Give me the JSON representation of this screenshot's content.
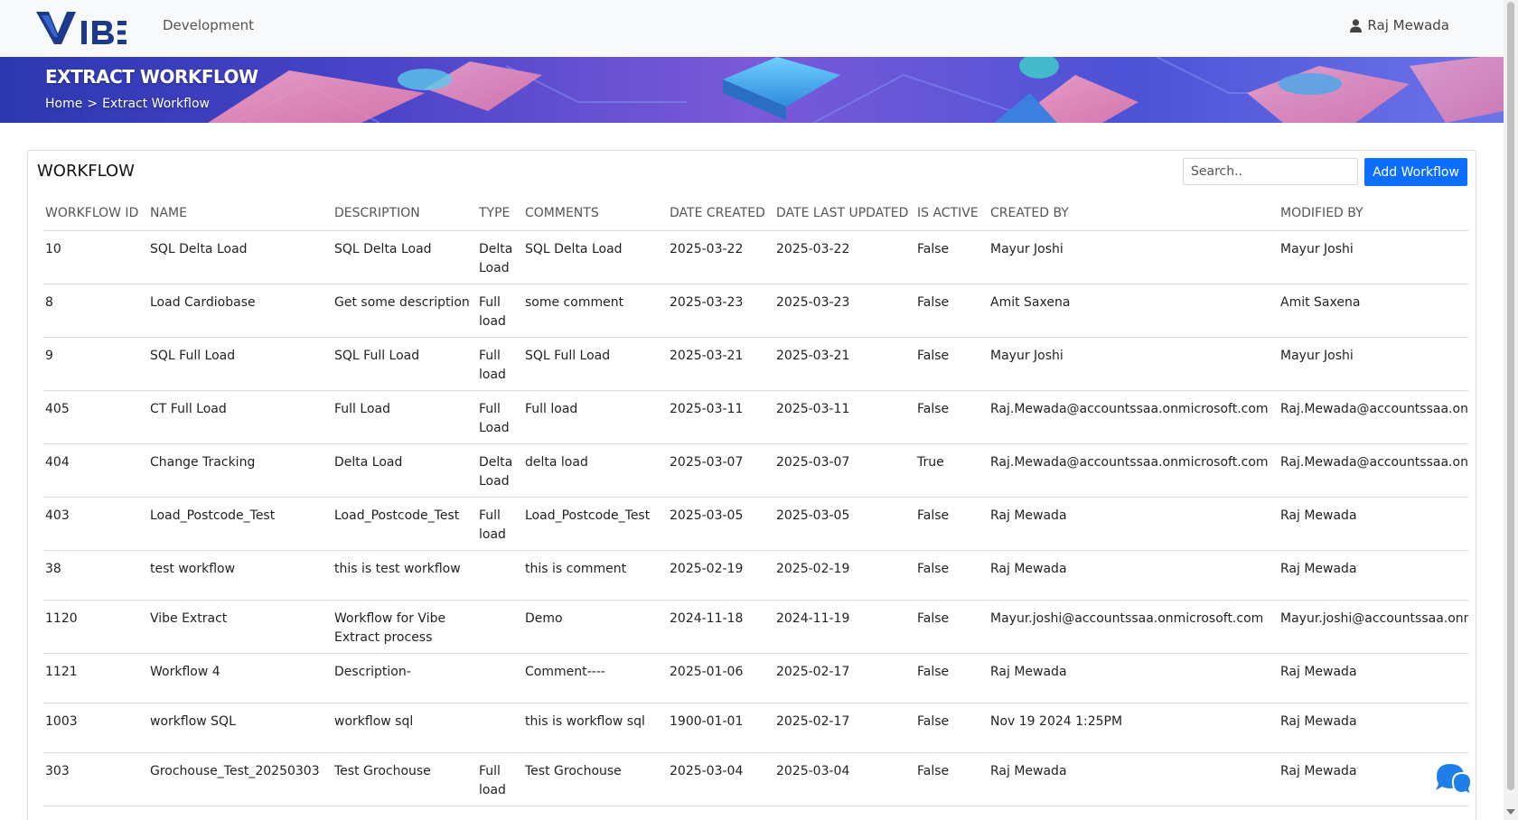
{
  "navbar": {
    "logo_text": "VIBE",
    "environment": "Development",
    "user_name": "Raj Mewada"
  },
  "banner": {
    "title": "EXTRACT WORKFLOW",
    "breadcrumb": {
      "home": "Home",
      "separator": ">",
      "current": "Extract Workflow"
    }
  },
  "card": {
    "title": "WORKFLOW",
    "search_placeholder": "Search..",
    "add_button_label": "Add Workflow"
  },
  "table": {
    "columns": [
      "WORKFLOW ID",
      "NAME",
      "DESCRIPTION",
      "TYPE",
      "COMMENTS",
      "DATE CREATED",
      "DATE LAST UPDATED",
      "IS ACTIVE",
      "CREATED BY",
      "MODIFIED BY"
    ],
    "rows": [
      {
        "id": "10",
        "name": "SQL Delta Load",
        "description": "SQL Delta Load",
        "type": "Delta Load",
        "comments": "SQL Delta Load",
        "date_created": "2025-03-22",
        "date_updated": "2025-03-22",
        "is_active": "False",
        "created_by": "Mayur Joshi",
        "modified_by": "Mayur Joshi"
      },
      {
        "id": "8",
        "name": "Load Cardiobase",
        "description": "Get some description",
        "type": "Full load",
        "comments": "some comment",
        "date_created": "2025-03-23",
        "date_updated": "2025-03-23",
        "is_active": "False",
        "created_by": "Amit Saxena",
        "modified_by": "Amit Saxena"
      },
      {
        "id": "9",
        "name": "SQL Full Load",
        "description": "SQL Full Load",
        "type": "Full load",
        "comments": "SQL Full Load",
        "date_created": "2025-03-21",
        "date_updated": "2025-03-21",
        "is_active": "False",
        "created_by": "Mayur Joshi",
        "modified_by": "Mayur Joshi"
      },
      {
        "id": "405",
        "name": "CT Full Load",
        "description": "Full Load",
        "type": "Full Load",
        "comments": "Full load",
        "date_created": "2025-03-11",
        "date_updated": "2025-03-11",
        "is_active": "False",
        "created_by": "Raj.Mewada@accountssaa.onmicrosoft.com",
        "modified_by": "Raj.Mewada@accountssaa.onmicrosoft.com"
      },
      {
        "id": "404",
        "name": "Change Tracking",
        "description": "Delta Load",
        "type": "Delta Load",
        "comments": "delta load",
        "date_created": "2025-03-07",
        "date_updated": "2025-03-07",
        "is_active": "True",
        "created_by": "Raj.Mewada@accountssaa.onmicrosoft.com",
        "modified_by": "Raj.Mewada@accountssaa.onmicrosoft.com"
      },
      {
        "id": "403",
        "name": "Load_Postcode_Test",
        "description": "Load_Postcode_Test",
        "type": "Full load",
        "comments": "Load_Postcode_Test",
        "date_created": "2025-03-05",
        "date_updated": "2025-03-05",
        "is_active": "False",
        "created_by": "Raj Mewada",
        "modified_by": "Raj Mewada"
      },
      {
        "id": "38",
        "name": "test workflow",
        "description": "this is test workflow",
        "type": "",
        "comments": "this is comment",
        "date_created": "2025-02-19",
        "date_updated": "2025-02-19",
        "is_active": "False",
        "created_by": "Raj Mewada",
        "modified_by": "Raj Mewada"
      },
      {
        "id": "1120",
        "name": "Vibe Extract",
        "description": "Workflow for Vibe Extract process",
        "type": "",
        "comments": "Demo",
        "date_created": "2024-11-18",
        "date_updated": "2024-11-19",
        "is_active": "False",
        "created_by": "Mayur.joshi@accountssaa.onmicrosoft.com",
        "modified_by": "Mayur.joshi@accountssaa.onmicrosoft.com"
      },
      {
        "id": "1121",
        "name": "Workflow 4",
        "description": "Description-",
        "type": "",
        "comments": "Comment----",
        "date_created": "2025-01-06",
        "date_updated": "2025-02-17",
        "is_active": "False",
        "created_by": "Raj Mewada",
        "modified_by": "Raj Mewada"
      },
      {
        "id": "1003",
        "name": "workflow SQL",
        "description": "workflow sql",
        "type": "",
        "comments": "this is workflow sql",
        "date_created": "1900-01-01",
        "date_updated": "2025-02-17",
        "is_active": "False",
        "created_by": "Nov 19 2024 1:25PM",
        "modified_by": "Raj Mewada"
      },
      {
        "id": "303",
        "name": "Grochouse_Test_20250303",
        "description": "Test Grochouse",
        "type": "Full load",
        "comments": "Test Grochouse",
        "date_created": "2025-03-04",
        "date_updated": "2025-03-04",
        "is_active": "False",
        "created_by": "Raj Mewada",
        "modified_by": "Raj Mewada"
      }
    ]
  },
  "icons": {
    "user": "user-icon",
    "chat": "chat-icon"
  },
  "colors": {
    "primary": "#0d6efd",
    "logo_blue": "#1d3a8a",
    "chat_blue": "#1e7fe8"
  }
}
